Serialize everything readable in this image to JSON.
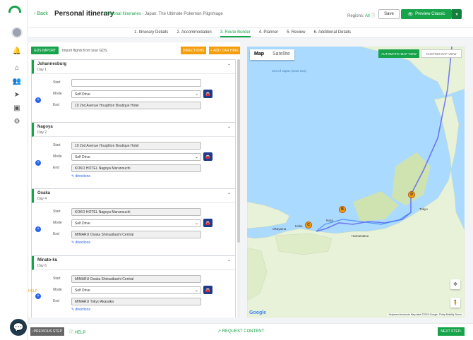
{
  "header": {
    "back_label": "Back",
    "title": "Personal itinerary",
    "crumb_root": "Personal Itineraries",
    "crumb_sep": "›",
    "crumb_current": "Japan: The Ultimate Pokemon Pilgrimage",
    "regions_label": "Regions:",
    "regions_value": "All",
    "save_label": "Save",
    "preview_label": "Preview Classic",
    "preview_caret": "▾"
  },
  "tabs": [
    {
      "label": "1. Itinerary Details"
    },
    {
      "label": "2. Accommodation"
    },
    {
      "label": "3. Route Builder"
    },
    {
      "label": "4. Planner"
    },
    {
      "label": "5. Review"
    },
    {
      "label": "6. Additional Details"
    }
  ],
  "toolbar": {
    "gds_label": "GDS IMPORT",
    "gds_note": "Import flights from your GDS.",
    "directions_label": "DIRECTIONS",
    "carhire_label": "+ ADD CAR HIRE"
  },
  "field_labels": {
    "start": "Start",
    "mode": "Mode",
    "end": "End",
    "directions": "directions"
  },
  "days": [
    {
      "name": "Johannesburg",
      "day": "Day 1",
      "start": "",
      "mode": "Self Drive",
      "end": "10 2nd Avenue Houghton Boutique Hotel",
      "directions": false
    },
    {
      "name": "Nagoya",
      "day": "Day 2",
      "start": "10 2nd Avenue Houghton Boutique Hotel",
      "mode": "Self Drive",
      "end": "KOKO HOTEL Nagoya Marunouchi",
      "directions": true
    },
    {
      "name": "Osaka",
      "day": "Day 4",
      "start": "KOKO HOTEL Nagoya Marunouchi",
      "mode": "Self Drive",
      "end": "MIMARU Osaka Shinsaibashi Central",
      "directions": true
    },
    {
      "name": "Minato-ku",
      "day": "Day 6",
      "start": "MIMARU Osaka Shinsaibashi Central",
      "mode": "Self Drive",
      "end": "MIMARU Tokyo Akasaka",
      "directions": true
    }
  ],
  "help_float": "HELP",
  "map": {
    "type_map": "Map",
    "type_satellite": "Satellite",
    "auto_view": "AUTOMATIC MAP VIEW",
    "custom_view": "CUSTOM MAP VIEW",
    "google": "Google",
    "attribution": "Keyboard shortcuts   Map data ©2024 Google, TMap Mobility   Terms",
    "markers": [
      {
        "id": "B",
        "label": "B"
      },
      {
        "id": "C",
        "label": "C"
      },
      {
        "id": "D",
        "label": "D"
      }
    ],
    "sea_label": "Sea of Japan (East Sea)",
    "place_labels": [
      "Tokyo",
      "Kobe",
      "Nara",
      "Okayama",
      "Hamamatsu"
    ]
  },
  "footer": {
    "prev_label": "PREVIOUS STEP",
    "help_label": "HELP",
    "request_label": "REQUEST CONTENT",
    "next_label": "NEXT STEP"
  },
  "colors": {
    "brand": "#16a34a",
    "accent": "#f59e0b",
    "navy": "#1e3a8a",
    "sea": "#aadaff",
    "land": "#e8f2d8"
  }
}
